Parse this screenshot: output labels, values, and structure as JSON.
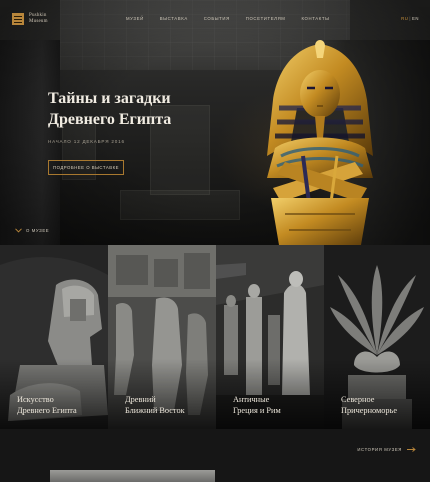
{
  "header": {
    "logo_line1": "Pushkin",
    "logo_line2": "Museum",
    "nav": [
      "Музей",
      "Выставка",
      "События",
      "Посетителям",
      "Контакты"
    ],
    "lang_active": "RU",
    "lang_separator": "|",
    "lang_other": "EN"
  },
  "hero": {
    "title_line1": "Тайны и загадки",
    "title_line2": "Древнего Египта",
    "date": "Начало 12 декабря 2016",
    "button_label": "Подробнее о выставке",
    "about_link": "О музее"
  },
  "collections": [
    {
      "line1": "Искусство",
      "line2": "Древнего Египта"
    },
    {
      "line1": "Древний",
      "line2": "Ближний Восток"
    },
    {
      "line1": "Античные",
      "line2": "Греция и Рим"
    },
    {
      "line1": "Северное",
      "line2": "Причерноморье"
    }
  ],
  "footer": {
    "history_link": "История музея"
  },
  "colors": {
    "accent": "#b8863b",
    "background": "#151515",
    "text": "#e8e1d4"
  },
  "icons": {
    "about": "chevron-down-icon",
    "history": "arrow-right-icon",
    "logo": "museum-logo-icon"
  }
}
